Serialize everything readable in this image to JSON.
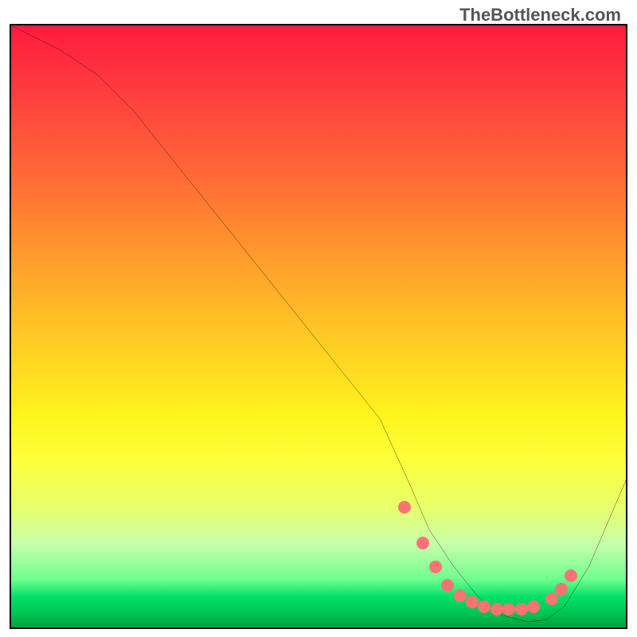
{
  "watermark": "TheBottleneck.com",
  "chart_data": {
    "type": "line",
    "title": "",
    "xlabel": "",
    "ylabel": "",
    "xlim": [
      0,
      100
    ],
    "ylim": [
      0,
      100
    ],
    "series": [
      {
        "name": "curve",
        "x": [
          0,
          8,
          14,
          20,
          28,
          36,
          44,
          52,
          60,
          65,
          68,
          72,
          76,
          80,
          84,
          87,
          90,
          94,
          97,
          100
        ],
        "values": [
          100,
          96,
          92,
          86,
          76,
          66,
          56,
          46,
          36,
          25,
          18,
          12,
          7,
          4,
          3.0,
          3.3,
          5.5,
          12,
          19,
          26
        ]
      }
    ],
    "markers": {
      "x": [
        64,
        67,
        69,
        71,
        73,
        75,
        77,
        79,
        81,
        83,
        85,
        88,
        89.5,
        91
      ],
      "values": [
        20,
        14,
        10,
        7,
        5.3,
        4.2,
        3.5,
        3.1,
        3,
        3.1,
        3.4,
        4.7,
        6.4,
        8.6
      ]
    },
    "background_gradient": {
      "orientation": "vertical",
      "stops": [
        {
          "pos": 0,
          "color": "#ff1a3f"
        },
        {
          "pos": 25,
          "color": "#ff6a36"
        },
        {
          "pos": 52,
          "color": "#ffca24"
        },
        {
          "pos": 72,
          "color": "#fcff3a"
        },
        {
          "pos": 92,
          "color": "#6eff8e"
        },
        {
          "pos": 100,
          "color": "#00a040"
        }
      ]
    }
  }
}
